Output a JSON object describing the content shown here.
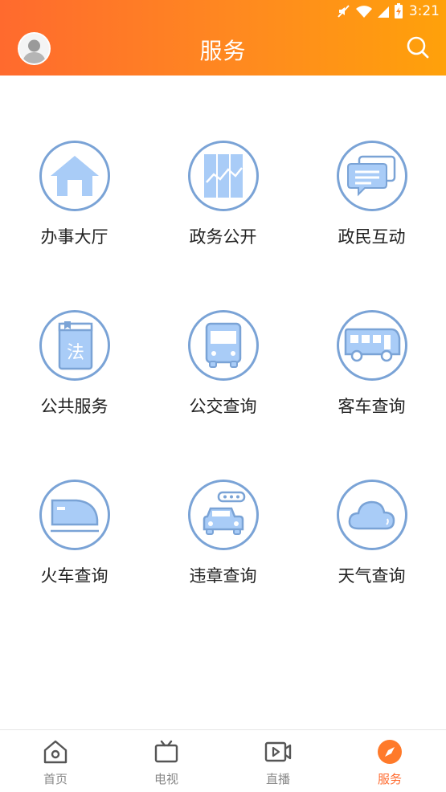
{
  "status_bar": {
    "time": "3:21"
  },
  "header": {
    "title": "服务"
  },
  "services": [
    {
      "label": "办事大厅",
      "icon": "house-icon"
    },
    {
      "label": "政务公开",
      "icon": "chart-panel-icon"
    },
    {
      "label": "政民互动",
      "icon": "chat-bubbles-icon"
    },
    {
      "label": "公共服务",
      "icon": "law-book-icon",
      "icon_text": "法"
    },
    {
      "label": "公交查询",
      "icon": "bus-front-icon"
    },
    {
      "label": "客车查询",
      "icon": "coach-bus-icon"
    },
    {
      "label": "火车查询",
      "icon": "train-icon"
    },
    {
      "label": "违章查询",
      "icon": "car-violation-icon"
    },
    {
      "label": "天气查询",
      "icon": "cloud-icon"
    }
  ],
  "tabbar": {
    "items": [
      {
        "label": "首页",
        "icon": "home-icon",
        "active": false
      },
      {
        "label": "电视",
        "icon": "tv-icon",
        "active": false
      },
      {
        "label": "直播",
        "icon": "video-icon",
        "active": false
      },
      {
        "label": "服务",
        "icon": "compass-icon",
        "active": true
      }
    ]
  },
  "colors": {
    "header_start": "#ff6a2e",
    "header_end": "#ffa10a",
    "icon_ring": "#7aa3d6",
    "icon_fill": "#a9ccf7",
    "tab_active": "#ff6a2e",
    "tab_inactive": "#888888"
  }
}
